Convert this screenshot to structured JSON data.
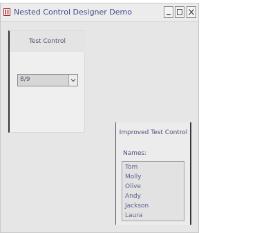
{
  "window": {
    "title": "Nested Control Designer Demo"
  },
  "test_control": {
    "header": "Test Control",
    "combo_value": "8/9"
  },
  "improved_control": {
    "header": "Improved Test Control",
    "names_label": "Names:",
    "names": [
      "Tom",
      "Molly",
      "Olive",
      "Andy",
      "Jackson",
      "Laura"
    ]
  }
}
